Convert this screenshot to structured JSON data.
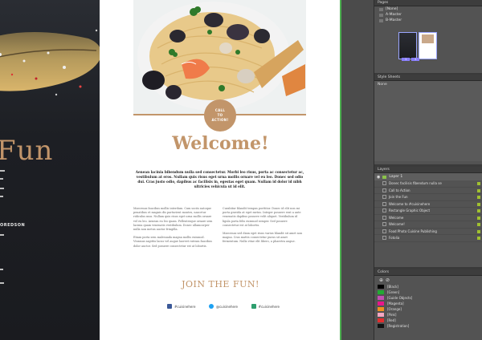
{
  "left_page": {
    "headline": "Fun",
    "name": "OREDSON"
  },
  "page": {
    "cta_line1": "CALL",
    "cta_line2": "TO",
    "cta_line3": "ACTION!",
    "welcome": "Welcome!",
    "intro": "Aenean lacinia bibendum nulla sed consectetur. Morbi leo risus, porta ac consectetur ac, vestibulum at eros. Nullam quis risus eget urna mollis ornare vel eu leo. Donec sed odio dui. Cras justo odio, dapibus ac facilisis in, egestas eget quam. Nullam id dolor id nibh ultricies vehicula ut id elit.",
    "col1_p1": "Maecenas faucibus mollis interdum. Cum sociis natoque penatibus et magnis dis parturient montes, nascetur ridiculus mus. Nullam quis risus eget urna mollis ornare vel eu leo. Aenean eu leo quam. Pellentesque ornare sem lacinia quam venenatis vestibulum. Donec ullamcorper nulla non metus auctor fringilla.",
    "col1_p2": "Etiam porta sem malesuada magna mollis euismod. Vivamus sagittis lacus vel augue laoreet rutrum faucibus dolor auctor. Sed posuere consectetur est at lobortis.",
    "col2_p1": "Curabitur blandit tempus porttitor. Donec id elit non mi porta gravida at eget metus. Integer posuere erat a ante venenatis dapibus posuere velit aliquet. Vestibulum id ligula porta felis euismod semper. Sed posuere consectetur est at lobortis.",
    "col2_p2": "Maecenas sed diam eget risus varius blandit sit amet non magna. Cras mattis consectetur purus sit amet fermentum. Nulla vitae elit libero, a pharetra augue.",
    "join": "JOIN THE FUN!",
    "socials": [
      {
        "icon": "facebook-icon",
        "label": "#cuisinehere",
        "color": "#3b5998"
      },
      {
        "icon": "twitter-icon",
        "label": "@cuisinehere",
        "color": "#1da1f2"
      },
      {
        "icon": "instagram-icon",
        "label": "#cuisinehere",
        "color": "#2e9e6e"
      }
    ]
  },
  "pages_panel": {
    "tab": "Pages",
    "items": [
      "[None]",
      "A-Master",
      "B-Master"
    ],
    "thumb_labels": [
      "1",
      "2"
    ]
  },
  "styles_panel": {
    "tab": "Style Sheets",
    "item": "None"
  },
  "layers_panel": {
    "tab": "Layers",
    "main_layer": "Layer 1",
    "items": [
      "Donec facilisis fibendum nulla se",
      "Call to Action",
      "Join the Fun",
      "Welcome to #cuisinehere",
      "Rectangle Graphic Object",
      "Welcome",
      "Welcome!",
      "Food Photo Cuisine Publishing",
      "Fotolia"
    ]
  },
  "colors_panel": {
    "tab": "Colors",
    "items": [
      {
        "name": "[Black]",
        "color": "#000000"
      },
      {
        "name": "[Green]",
        "color": "#22aa33"
      },
      {
        "name": "[Guide Objects]",
        "color": "#c24fb3"
      },
      {
        "name": "[Magenta]",
        "color": "#e8168b"
      },
      {
        "name": "[Orange]",
        "color": "#ef8f1e"
      },
      {
        "name": "[Pink]",
        "color": "#f5a6c2"
      },
      {
        "name": "[Red]",
        "color": "#e22d2d"
      },
      {
        "name": "[Registration]",
        "color": "#111111"
      }
    ]
  }
}
